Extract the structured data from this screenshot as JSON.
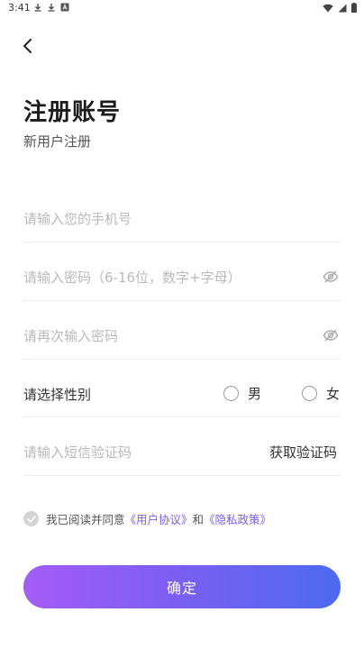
{
  "status_bar": {
    "time": "3:41"
  },
  "header": {
    "title": "注册账号",
    "subtitle": "新用户注册"
  },
  "form": {
    "phone_placeholder": "请输入您的手机号",
    "password_placeholder": "请输入密码（6-16位，数字+字母）",
    "confirm_password_placeholder": "请再次输入密码",
    "gender_label": "请选择性别",
    "gender_options": [
      "男",
      "女"
    ],
    "sms_code_placeholder": "请输入短信验证码",
    "get_code_label": "获取验证码"
  },
  "agreement": {
    "prefix": "我已阅读并同意",
    "user_agreement": "《用户协议》",
    "and": "和",
    "privacy_policy": "《隐私政策》",
    "checked": false
  },
  "confirm_label": "确定",
  "colors": {
    "accent_start": "#a45cf7",
    "accent_end": "#4d6af0",
    "link": "#7b5cf0"
  }
}
